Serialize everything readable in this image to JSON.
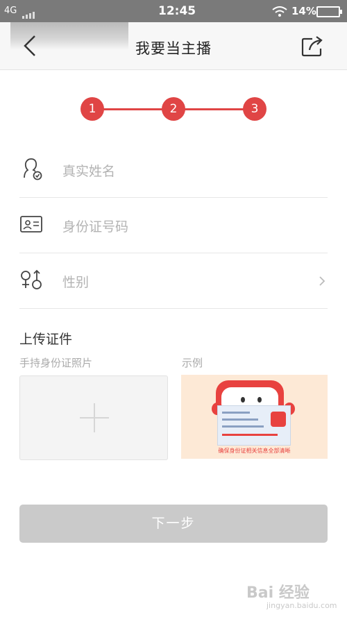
{
  "status_bar": {
    "network": "4G",
    "time": "12:45",
    "battery": "14%"
  },
  "nav": {
    "title": "我要当主播",
    "back_icon": "chevron-left-icon",
    "share_icon": "share-icon"
  },
  "steps": [
    "1",
    "2",
    "3"
  ],
  "form": {
    "name_placeholder": "真实姓名",
    "id_placeholder": "身份证号码",
    "gender_placeholder": "性别"
  },
  "upload": {
    "title": "上传证件",
    "hold_label": "手持身份证照片",
    "example_label": "示例",
    "example_caption": "确保身份证相关信息全部清晰"
  },
  "next_button": "下一步",
  "watermark": {
    "main": "Bai 经验",
    "sub": "jingyan.baidu.com"
  },
  "colors": {
    "accent": "#e04545",
    "button_disabled": "#cacaca"
  }
}
